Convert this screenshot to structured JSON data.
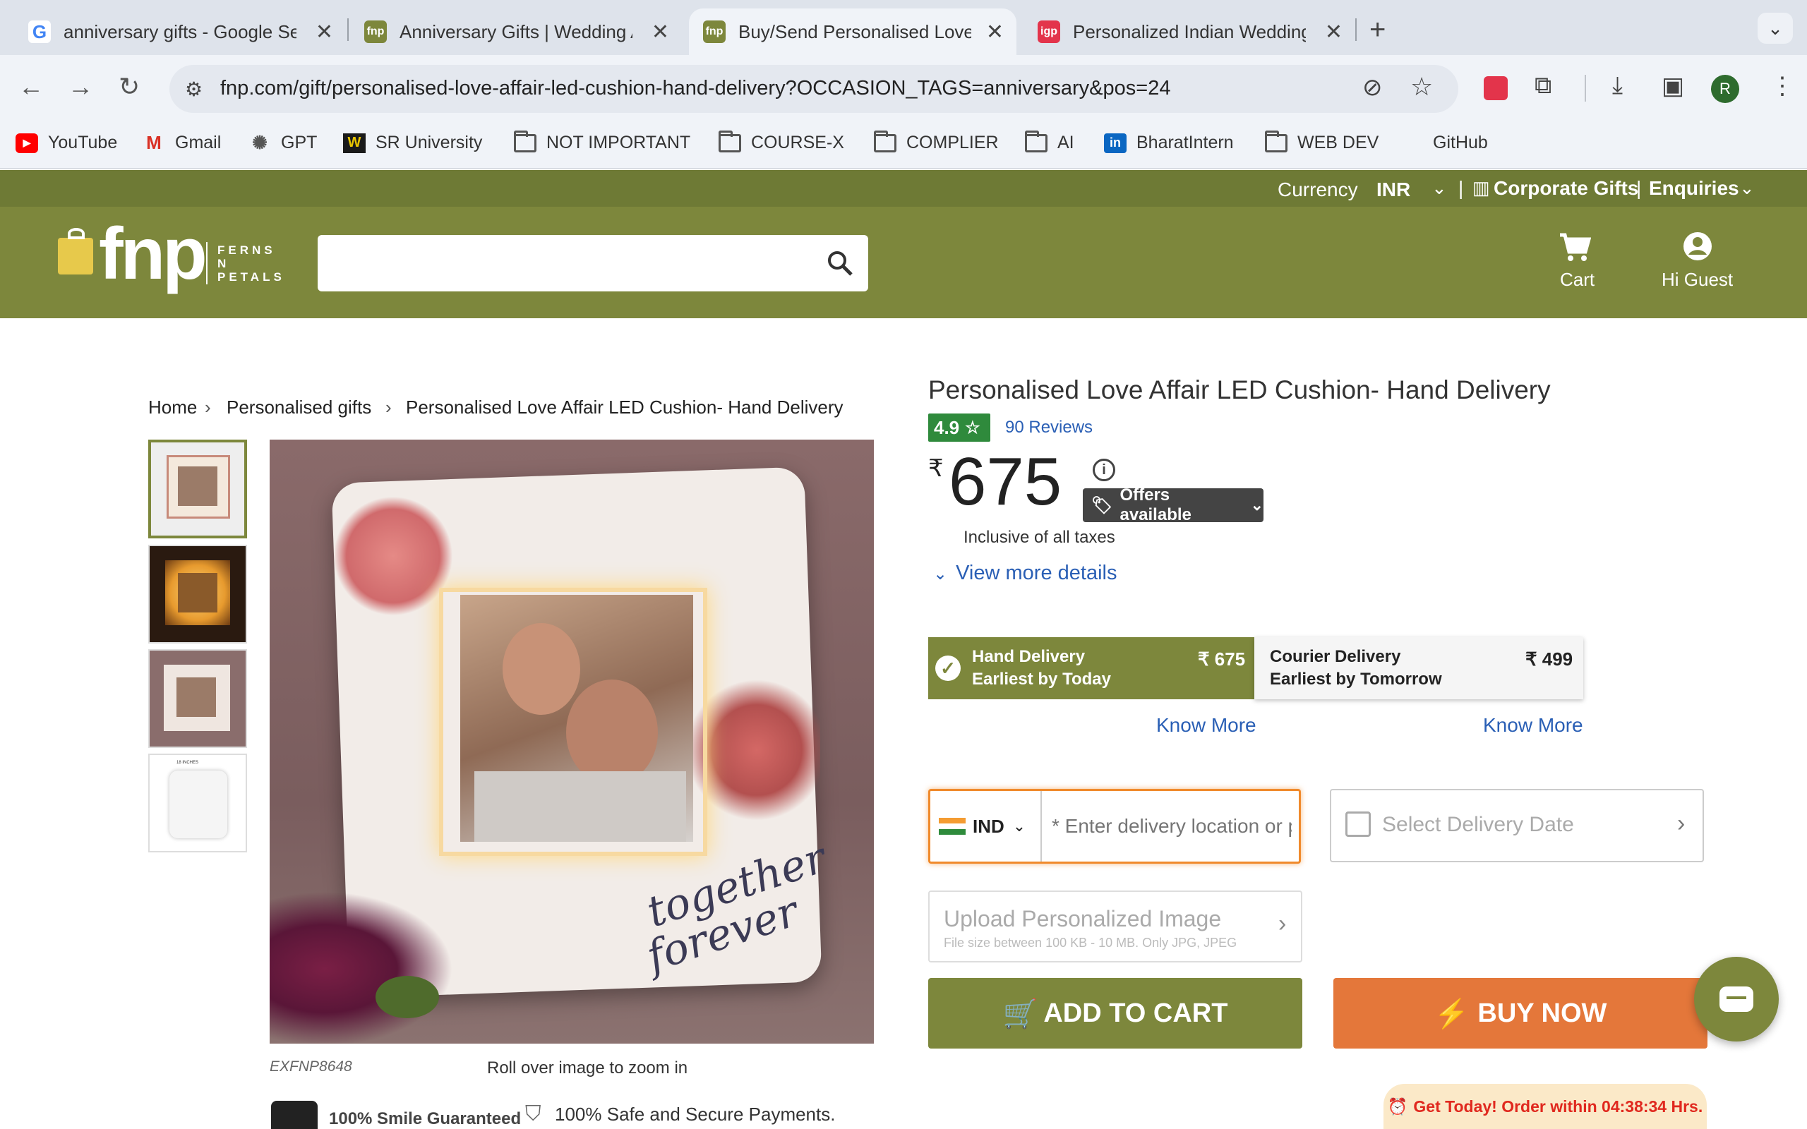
{
  "browser": {
    "tabs": [
      {
        "title": "anniversary gifts - Google Search",
        "favicon": "G"
      },
      {
        "title": "Anniversary Gifts | Wedding Anniversary",
        "favicon": "fnp"
      },
      {
        "title": "Buy/Send Personalised Love Affair",
        "favicon": "fnp"
      },
      {
        "title": "Personalized Indian Wedding",
        "favicon": "igp"
      }
    ],
    "url": "fnp.com/gift/personalised-love-affair-led-cushion-hand-delivery?OCCASION_TAGS=anniversary&pos=24",
    "profile_initial": "R",
    "bookmarks": [
      "YouTube",
      "Gmail",
      "GPT",
      "SR University",
      "NOT IMPORTANT",
      "COURSE-X",
      "COMPLIER",
      "AI",
      "BharatIntern",
      "WEB DEV",
      "GitHub"
    ]
  },
  "site": {
    "currency_label": "Currency",
    "currency_value": "INR",
    "corporate_gifts": "Corporate Gifts",
    "enquiries": "Enquiries",
    "logo_text": "fnp",
    "logo_sub": [
      "FERNS",
      "N",
      "PETALS"
    ],
    "cart": "Cart",
    "account": "Hi Guest",
    "brand_color": "#7d873c"
  },
  "breadcrumb": [
    "Home",
    "Personalised gifts",
    "Personalised Love Affair LED Cushion- Hand Delivery"
  ],
  "product": {
    "title": "Personalised Love Affair LED Cushion- Hand Delivery",
    "rating": "4.9",
    "reviews": "90 Reviews",
    "currency_symbol": "₹",
    "price": "675",
    "offers": "Offers available",
    "tax_note": "Inclusive of all taxes",
    "view_more": "View more details",
    "sku": "EXFNP8648",
    "zoom_hint": "Roll over image to zoom in",
    "image_caption": [
      "together",
      "forever"
    ],
    "thumb_caption": "18 INCHES"
  },
  "delivery": {
    "hand": {
      "name": "Hand Delivery",
      "eta": "Earliest by Today",
      "price": "₹ 675"
    },
    "courier": {
      "name": "Courier Delivery",
      "eta": "Earliest by Tomorrow",
      "price": "₹ 499"
    },
    "know_more": "Know More"
  },
  "form": {
    "country": "IND",
    "location_placeholder": "* Enter delivery location or pincode",
    "date_placeholder": "Select Delivery Date",
    "upload_title": "Upload Personalized Image",
    "upload_sub": "File size between 100 KB - 10 MB. Only JPG, JPEG"
  },
  "actions": {
    "add_to_cart": "ADD TO CART",
    "buy_now": "BUY NOW",
    "buy_color": "#e4773a"
  },
  "trust": {
    "smile": "100% Smile Guaranteed",
    "secure": "100% Safe and Secure Payments."
  },
  "promo": "Get Today! Order within 04:38:34 Hrs."
}
